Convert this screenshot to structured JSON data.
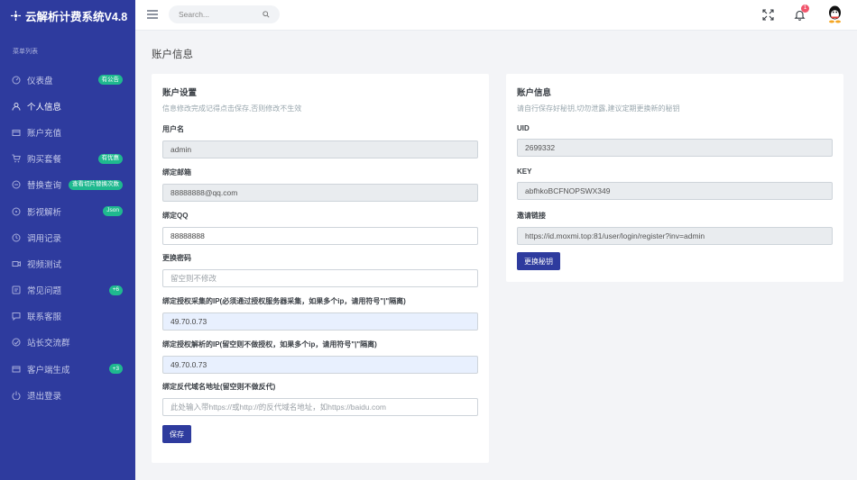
{
  "brand": {
    "title": "云解析计费系统V4.8"
  },
  "sidebar": {
    "section_title": "菜单列表",
    "items": [
      {
        "label": "仪表盘",
        "badge": "有公告",
        "icon": "dashboard-icon"
      },
      {
        "label": "个人信息",
        "badge": "",
        "icon": "user-icon"
      },
      {
        "label": "账户充值",
        "badge": "",
        "icon": "wallet-icon"
      },
      {
        "label": "购买套餐",
        "badge": "有优惠",
        "icon": "cart-icon"
      },
      {
        "label": "替换查询",
        "badge": "查看切片替换次数",
        "icon": "search-icon"
      },
      {
        "label": "影视解析",
        "badge": "Json",
        "icon": "film-icon"
      },
      {
        "label": "调用记录",
        "badge": "",
        "icon": "history-icon"
      },
      {
        "label": "视频测试",
        "badge": "",
        "icon": "video-icon"
      },
      {
        "label": "常见问题",
        "badge": "+6",
        "icon": "help-icon"
      },
      {
        "label": "联系客服",
        "badge": "",
        "icon": "chat-icon"
      },
      {
        "label": "站长交流群",
        "badge": "",
        "icon": "group-icon"
      },
      {
        "label": "客户端生成",
        "badge": "+3",
        "icon": "client-icon"
      },
      {
        "label": "退出登录",
        "badge": "",
        "icon": "logout-icon"
      }
    ]
  },
  "topbar": {
    "search_placeholder": "Search...",
    "notification_count": "1"
  },
  "page": {
    "title": "账户信息"
  },
  "account_settings": {
    "title": "账户设置",
    "subtitle": "信息修改完成记得点击保存,否则修改不生效",
    "username_label": "用户名",
    "username_value": "admin",
    "email_label": "绑定邮箱",
    "email_value": "88888888@qq.com",
    "qq_label": "绑定QQ",
    "qq_value": "88888888",
    "password_label": "更换密码",
    "password_placeholder": "留空则不修改",
    "collect_ip_label": "绑定授权采集的IP(必须通过授权服务器采集，如果多个ip，请用符号\"|\"隔离)",
    "collect_ip_value": "49.70.0.73",
    "parse_ip_label": "绑定授权解析的IP(留空则不做授权，如果多个ip，请用符号\"|\"隔离)",
    "parse_ip_value": "49.70.0.73",
    "proxy_domain_label": "绑定反代域名地址(留空则不做反代)",
    "proxy_domain_placeholder": "此处输入带https://或http://的反代域名地址，如https://baidu.com",
    "save_label": "保存"
  },
  "account_info": {
    "title": "账户信息",
    "subtitle": "请自行保存好秘钥,切勿泄露,建议定期更换新的秘钥",
    "uid_label": "UID",
    "uid_value": "2699332",
    "key_label": "KEY",
    "key_value": "abfhkoBCFNOPSWX349",
    "invite_label": "邀请链接",
    "invite_value": "https://id.moxmi.top:81/user/login/register?inv=admin",
    "change_key_label": "更换秘钥"
  },
  "colors": {
    "sidebar_bg": "#2e3b9e",
    "badge": "#1fb98f",
    "primary_button": "#2e3b9e",
    "notification": "#f1556c"
  }
}
